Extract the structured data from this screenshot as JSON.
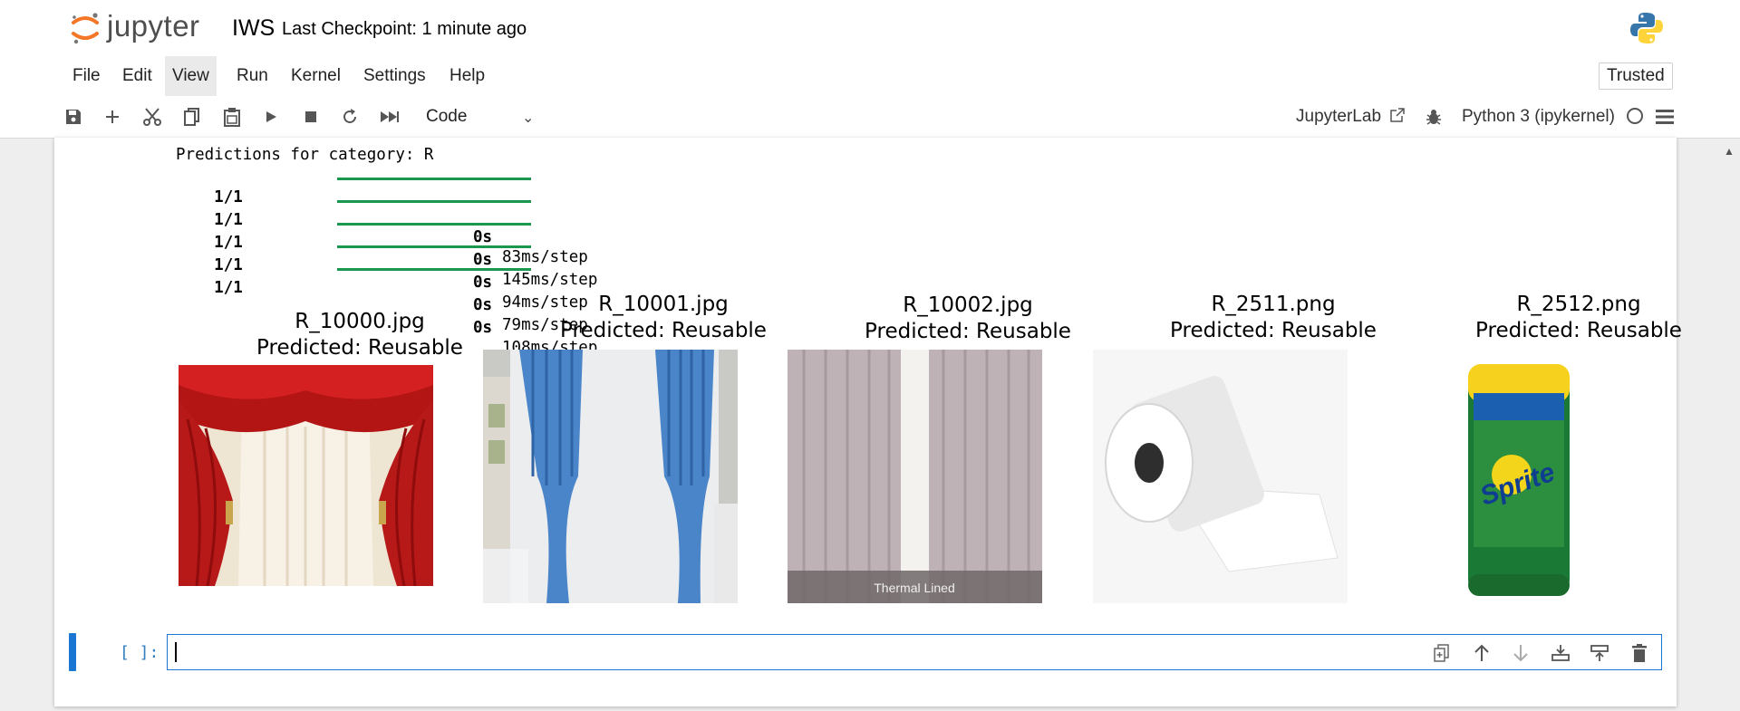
{
  "header": {
    "logo_text": "jupyter",
    "notebook_name": "IWS",
    "checkpoint": "Last Checkpoint: 1 minute ago"
  },
  "menu": {
    "items": [
      "File",
      "Edit",
      "View",
      "Run",
      "Kernel",
      "Settings",
      "Help"
    ],
    "active": "View",
    "trusted": "Trusted"
  },
  "toolbar": {
    "cell_type": "Code",
    "jupyterlab_label": "JupyterLab",
    "kernel_name": "Python 3 (ipykernel)"
  },
  "output": {
    "header": "Predictions for category: R",
    "progress_lines": [
      {
        "count": "1/1",
        "time": "0s",
        "step": "83ms/step",
        "progress": 1.0
      },
      {
        "count": "1/1",
        "time": "0s",
        "step": "145ms/step",
        "progress": 1.0
      },
      {
        "count": "1/1",
        "time": "0s",
        "step": "94ms/step",
        "progress": 1.0
      },
      {
        "count": "1/1",
        "time": "0s",
        "step": "79ms/step",
        "progress": 1.0
      },
      {
        "count": "1/1",
        "time": "0s",
        "step": "108ms/step",
        "progress": 1.0
      }
    ],
    "figures": [
      {
        "filename": "R_10000.jpg",
        "prediction": "Predicted: Reusable",
        "image": "red-theater-curtain"
      },
      {
        "filename": "R_10001.jpg",
        "prediction": "Predicted: Reusable",
        "image": "blue-window-curtains"
      },
      {
        "filename": "R_10002.jpg",
        "prediction": "Predicted: Reusable",
        "image": "thermal-lined-curtains",
        "image_caption": "Thermal Lined"
      },
      {
        "filename": "R_2511.png",
        "prediction": "Predicted: Reusable",
        "image": "toilet-paper-roll"
      },
      {
        "filename": "R_2512.png",
        "prediction": "Predicted: Reusable",
        "image": "sprite-can",
        "image_text": "Sprite"
      }
    ]
  },
  "input_cell": {
    "prompt": "[ ]:",
    "value": ""
  },
  "colors": {
    "progress_bar": "#1a9850",
    "active_cell": "#1976d2",
    "prompt": "#307fc1",
    "jupyter_orange": "#f37726"
  }
}
